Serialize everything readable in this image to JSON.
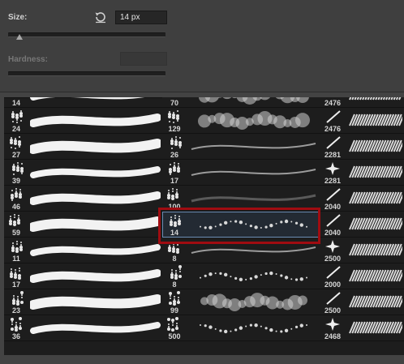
{
  "size": {
    "label": "Size:",
    "value": "14 px",
    "slider_level": 0.07
  },
  "hardness": {
    "label": "Hardness:",
    "value": "",
    "disabled": true
  },
  "brush_columns": [
    {
      "top_label": "14",
      "sizes": [
        "24",
        "27",
        "39",
        "46",
        "59",
        "11",
        "17",
        "23",
        "36"
      ]
    },
    {
      "top_label": "70",
      "sizes": [
        "129",
        "26",
        "17",
        "100",
        "14",
        "8",
        "8",
        "99",
        "500"
      ]
    },
    {
      "top_label": "2476",
      "sizes": [
        "2476",
        "2281",
        "2281",
        "2040",
        "2040",
        "2500",
        "2000",
        "2500",
        "2468"
      ]
    }
  ],
  "selected_brush": {
    "column": 1,
    "row": 4
  }
}
